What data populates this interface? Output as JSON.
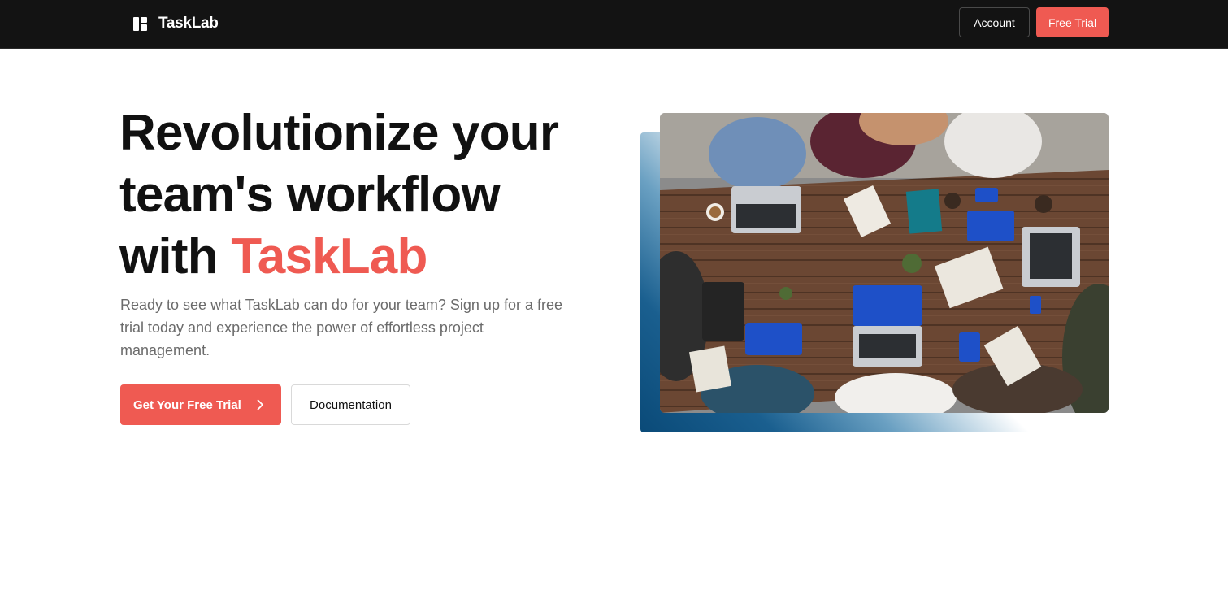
{
  "nav": {
    "brand": "TaskLab",
    "account_label": "Account",
    "free_trial_label": "Free Trial"
  },
  "hero": {
    "title_line1": "Revolutionize your",
    "title_line2": "team's workflow",
    "title_line3_prefix": "with",
    "title_accent": "TaskLab",
    "subtitle": "Ready to see what TaskLab can do for your team? Sign up for a free trial today and experience the power of effortless project management.",
    "cta_primary_label": "Get Your Free Trial",
    "cta_secondary_label": "Documentation",
    "image_alt": "team-collaborating-around-table-photo"
  },
  "colors": {
    "nav_bg": "#131313",
    "accent": "#ef5a52",
    "text": "#111111",
    "muted": "#6b6b6b",
    "gradient_blue": "#0a4a78"
  },
  "icons": {
    "logo": "tasklab-logo-icon",
    "cta_arrow": "chevron-right-icon"
  }
}
